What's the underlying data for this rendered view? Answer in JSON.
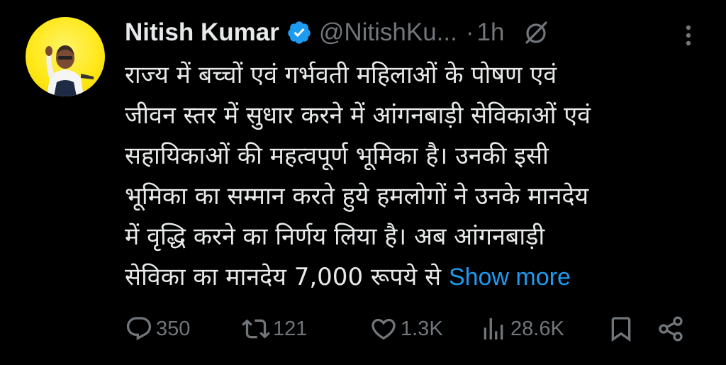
{
  "author": {
    "display_name": "Nitish Kumar",
    "handle": "@NitishKu...",
    "separator": "·",
    "time": "1h"
  },
  "tweet": {
    "lines": [
      "राज्य में बच्चों एवं गर्भवती महिलाओं के पोषण एवं",
      "जीवन स्तर में सुधार करने में आंगनबाड़ी सेविकाओं एवं",
      "सहायिकाओं की महत्वपूर्ण भूमिका है। उनकी इसी",
      "भूमिका का सम्मान करते हुये हमलोगों ने उनके मानदेय",
      "में वृद्धि करने का निर्णय लिया है। अब आंगनबाड़ी",
      "सेविका का मानदेय 7,000 रूपये से"
    ],
    "show_more": "Show more"
  },
  "actions": {
    "replies": "350",
    "reposts": "121",
    "likes": "1.3K",
    "views": "28.6K"
  },
  "icons": {
    "verified": "verified-badge-icon",
    "grok": "grok-icon",
    "more": "more-vertical-icon",
    "reply": "reply-icon",
    "repost": "repost-icon",
    "like": "heart-icon",
    "views": "views-icon",
    "bookmark": "bookmark-icon",
    "share": "share-icon"
  },
  "colors": {
    "background": "#000000",
    "text": "#e7e9ea",
    "muted": "#71767b",
    "link": "#1d9bf0",
    "avatar_bg": "#ffe81a"
  }
}
